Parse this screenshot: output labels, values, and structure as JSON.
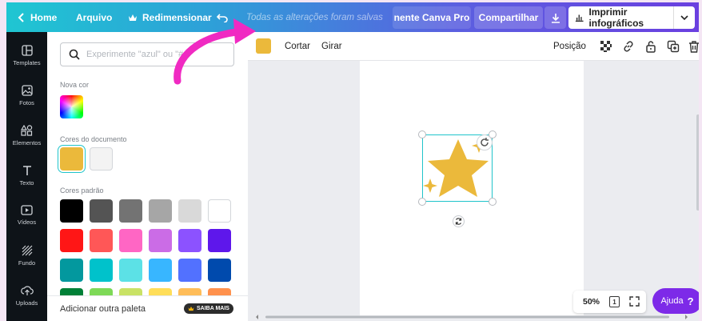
{
  "topbar": {
    "home": "Home",
    "file": "Arquivo",
    "resize": "Redimensionar",
    "saved": "Todas as alterações foram salvas",
    "pro_cta": "nente Canva Pro",
    "share": "Compartilhar",
    "print": "Imprimir infográficos"
  },
  "rail": [
    {
      "label": "Templates",
      "icon": "templates-icon"
    },
    {
      "label": "Fotos",
      "icon": "photos-icon"
    },
    {
      "label": "Elementos",
      "icon": "elements-icon"
    },
    {
      "label": "Texto",
      "icon": "text-icon"
    },
    {
      "label": "Vídeos",
      "icon": "video-icon"
    },
    {
      "label": "Fundo",
      "icon": "background-icon"
    },
    {
      "label": "Uploads",
      "icon": "upload-icon"
    }
  ],
  "panel": {
    "search_placeholder": "Experimente \"azul\" ou \"#",
    "new_color": "Nova cor",
    "document_colors": "Cores do documento",
    "default_colors": "Cores padrão",
    "add_palette": "Adicionar outra paleta",
    "learn_more": "SAIBA MAIS",
    "doc_swatches": [
      "#ebb93b",
      "#f3f3f3"
    ],
    "default_swatches": [
      [
        "#000000",
        "#545454",
        "#737373",
        "#a6a6a6",
        "#d9d9d9",
        "#ffffff"
      ],
      [
        "#ff1616",
        "#ff5757",
        "#ff66c4",
        "#cb6ce6",
        "#8c52ff",
        "#5e17eb"
      ],
      [
        "#03989e",
        "#00c2cb",
        "#5ce1e6",
        "#38b6ff",
        "#5271ff",
        "#004aad"
      ],
      [
        "#008037",
        "#7ed957",
        "#c9e265",
        "#ffde59",
        "#ffbd59",
        "#ff914d"
      ]
    ]
  },
  "ctxbar": {
    "color": "#ebb93b",
    "crop": "Cortar",
    "flip": "Girar",
    "position": "Posição"
  },
  "canvas": {
    "star_color": "#ebb93b"
  },
  "zoom": {
    "value": "50%",
    "page": "1"
  },
  "help": {
    "label": "Ajuda",
    "mark": "?"
  }
}
